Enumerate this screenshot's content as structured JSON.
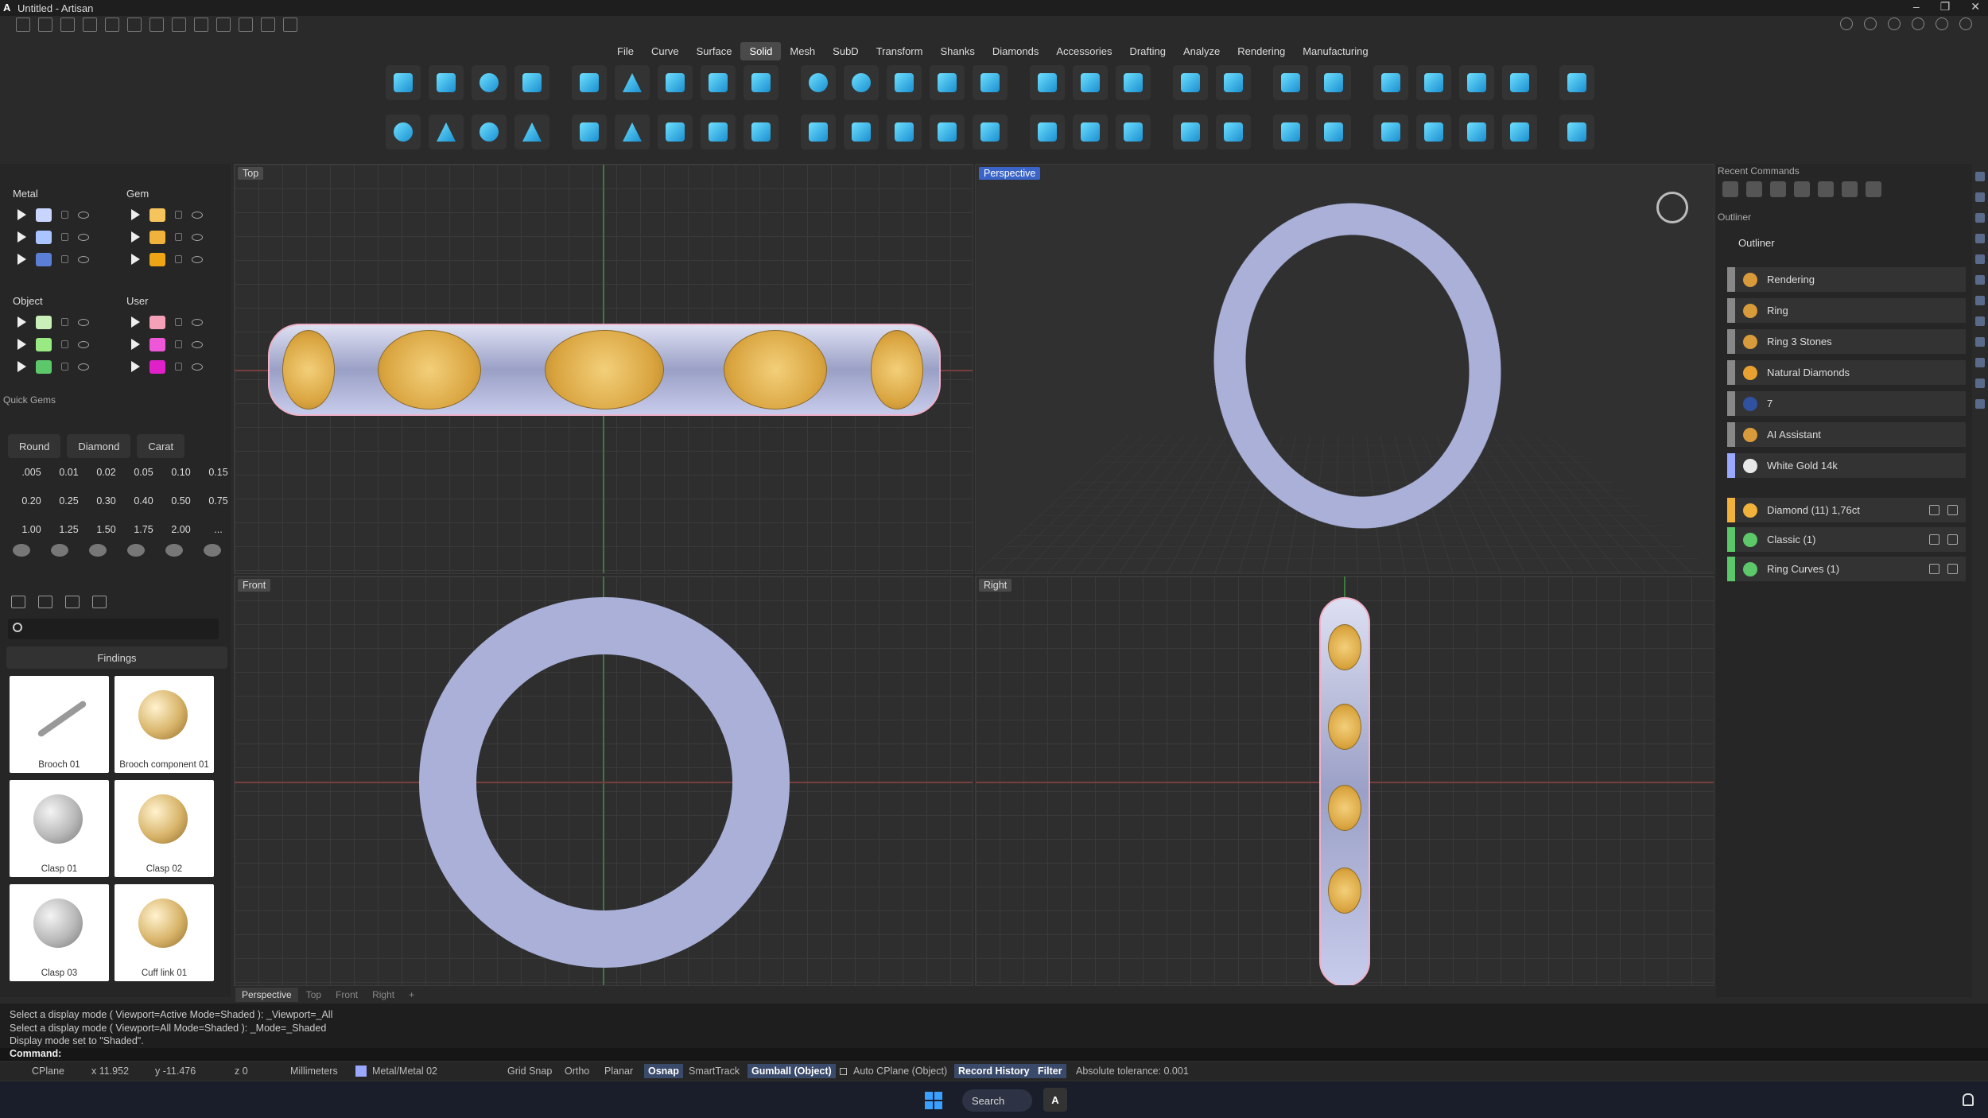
{
  "window": {
    "title": "Untitled - Artisan",
    "controls": [
      "–",
      "❐",
      "✕"
    ]
  },
  "menu": [
    {
      "label": "File"
    },
    {
      "label": "Curve"
    },
    {
      "label": "Surface"
    },
    {
      "label": "Solid",
      "active": true
    },
    {
      "label": "Mesh"
    },
    {
      "label": "SubD"
    },
    {
      "label": "Transform"
    },
    {
      "label": "Shanks"
    },
    {
      "label": "Diamonds"
    },
    {
      "label": "Accessories"
    },
    {
      "label": "Drafting"
    },
    {
      "label": "Analyze"
    },
    {
      "label": "Rendering"
    },
    {
      "label": "Manufacturing"
    }
  ],
  "layers": {
    "metal": {
      "title": "Metal",
      "colors": [
        "#c9d4ff",
        "#a9c4ff",
        "#5b7fd6"
      ]
    },
    "gem": {
      "title": "Gem",
      "colors": [
        "#f5c45c",
        "#f0b23a",
        "#eea515"
      ]
    },
    "object": {
      "title": "Object",
      "colors": [
        "#c8f0b8",
        "#9aea84",
        "#5cc86a"
      ]
    },
    "user": {
      "title": "User",
      "colors": [
        "#f4a0b8",
        "#ee58d8",
        "#e020c8"
      ]
    }
  },
  "quick_gems": {
    "title": "Quick Gems",
    "types": [
      "Round",
      "Diamond",
      "Carat"
    ],
    "carats": [
      ".005",
      "0.01",
      "0.02",
      "0.05",
      "0.10",
      "0.15",
      "0.20",
      "0.25",
      "0.30",
      "0.40",
      "0.50",
      "0.75",
      "1.00",
      "1.25",
      "1.50",
      "1.75",
      "2.00",
      "..."
    ]
  },
  "library": {
    "category": "Findings",
    "items": [
      "Brooch 01",
      "Brooch component 01",
      "Clasp 01",
      "Clasp 02",
      "Clasp 03",
      "Cuff link 01"
    ]
  },
  "viewports": {
    "top": "Top",
    "perspective": "Perspective",
    "front": "Front",
    "right": "Right"
  },
  "viewport_tabs": [
    "Perspective",
    "Top",
    "Front",
    "Right",
    "+"
  ],
  "right_panel": {
    "recent_title": "Recent Commands",
    "outliner_title": "Outliner",
    "outliner_label": "Outliner",
    "items": [
      {
        "label": "Rendering",
        "bar": "#888888",
        "icon": "#d89a3a"
      },
      {
        "label": "Ring",
        "bar": "#888888",
        "icon": "#d89a3a"
      },
      {
        "label": "Ring 3 Stones",
        "bar": "#888888",
        "icon": "#d89a3a"
      },
      {
        "label": "Natural Diamonds",
        "bar": "#888888",
        "icon": "#e8a030"
      },
      {
        "label": "7",
        "bar": "#888888",
        "icon": "#3050a0"
      },
      {
        "label": "AI Assistant",
        "bar": "#888888",
        "icon": "#d89a3a"
      },
      {
        "label": "White Gold 14k",
        "bar": "#9aa8ff",
        "icon": "#e8e8e8"
      }
    ],
    "layers": [
      {
        "label": "Diamond (11) 1,76ct",
        "bar": "#f0b23a"
      },
      {
        "label": "Classic (1)",
        "bar": "#5cc86a"
      },
      {
        "label": "Ring Curves (1)",
        "bar": "#5cc86a"
      }
    ]
  },
  "command_history": [
    "Select a display mode ( Viewport=Active  Mode=Shaded ): _Viewport=_All",
    "Select a display mode ( Viewport=All  Mode=Shaded ): _Mode=_Shaded",
    "Display mode set to \"Shaded\"."
  ],
  "command_prompt": "Command:",
  "status": {
    "cplane": "CPlane",
    "x": "x 11.952",
    "y": "y -11.476",
    "z": "z 0",
    "units": "Millimeters",
    "layer": "Metal/Metal 02",
    "grid_snap": "Grid Snap",
    "ortho": "Ortho",
    "planar": "Planar",
    "osnap": "Osnap",
    "smarttrack": "SmartTrack",
    "gumball": "Gumball (Object)",
    "auto_cplane": "Auto CPlane (Object)",
    "record_history": "Record History",
    "filter": "Filter",
    "tolerance": "Absolute tolerance: 0.001"
  },
  "taskbar": {
    "search": "Search",
    "app": "A"
  }
}
